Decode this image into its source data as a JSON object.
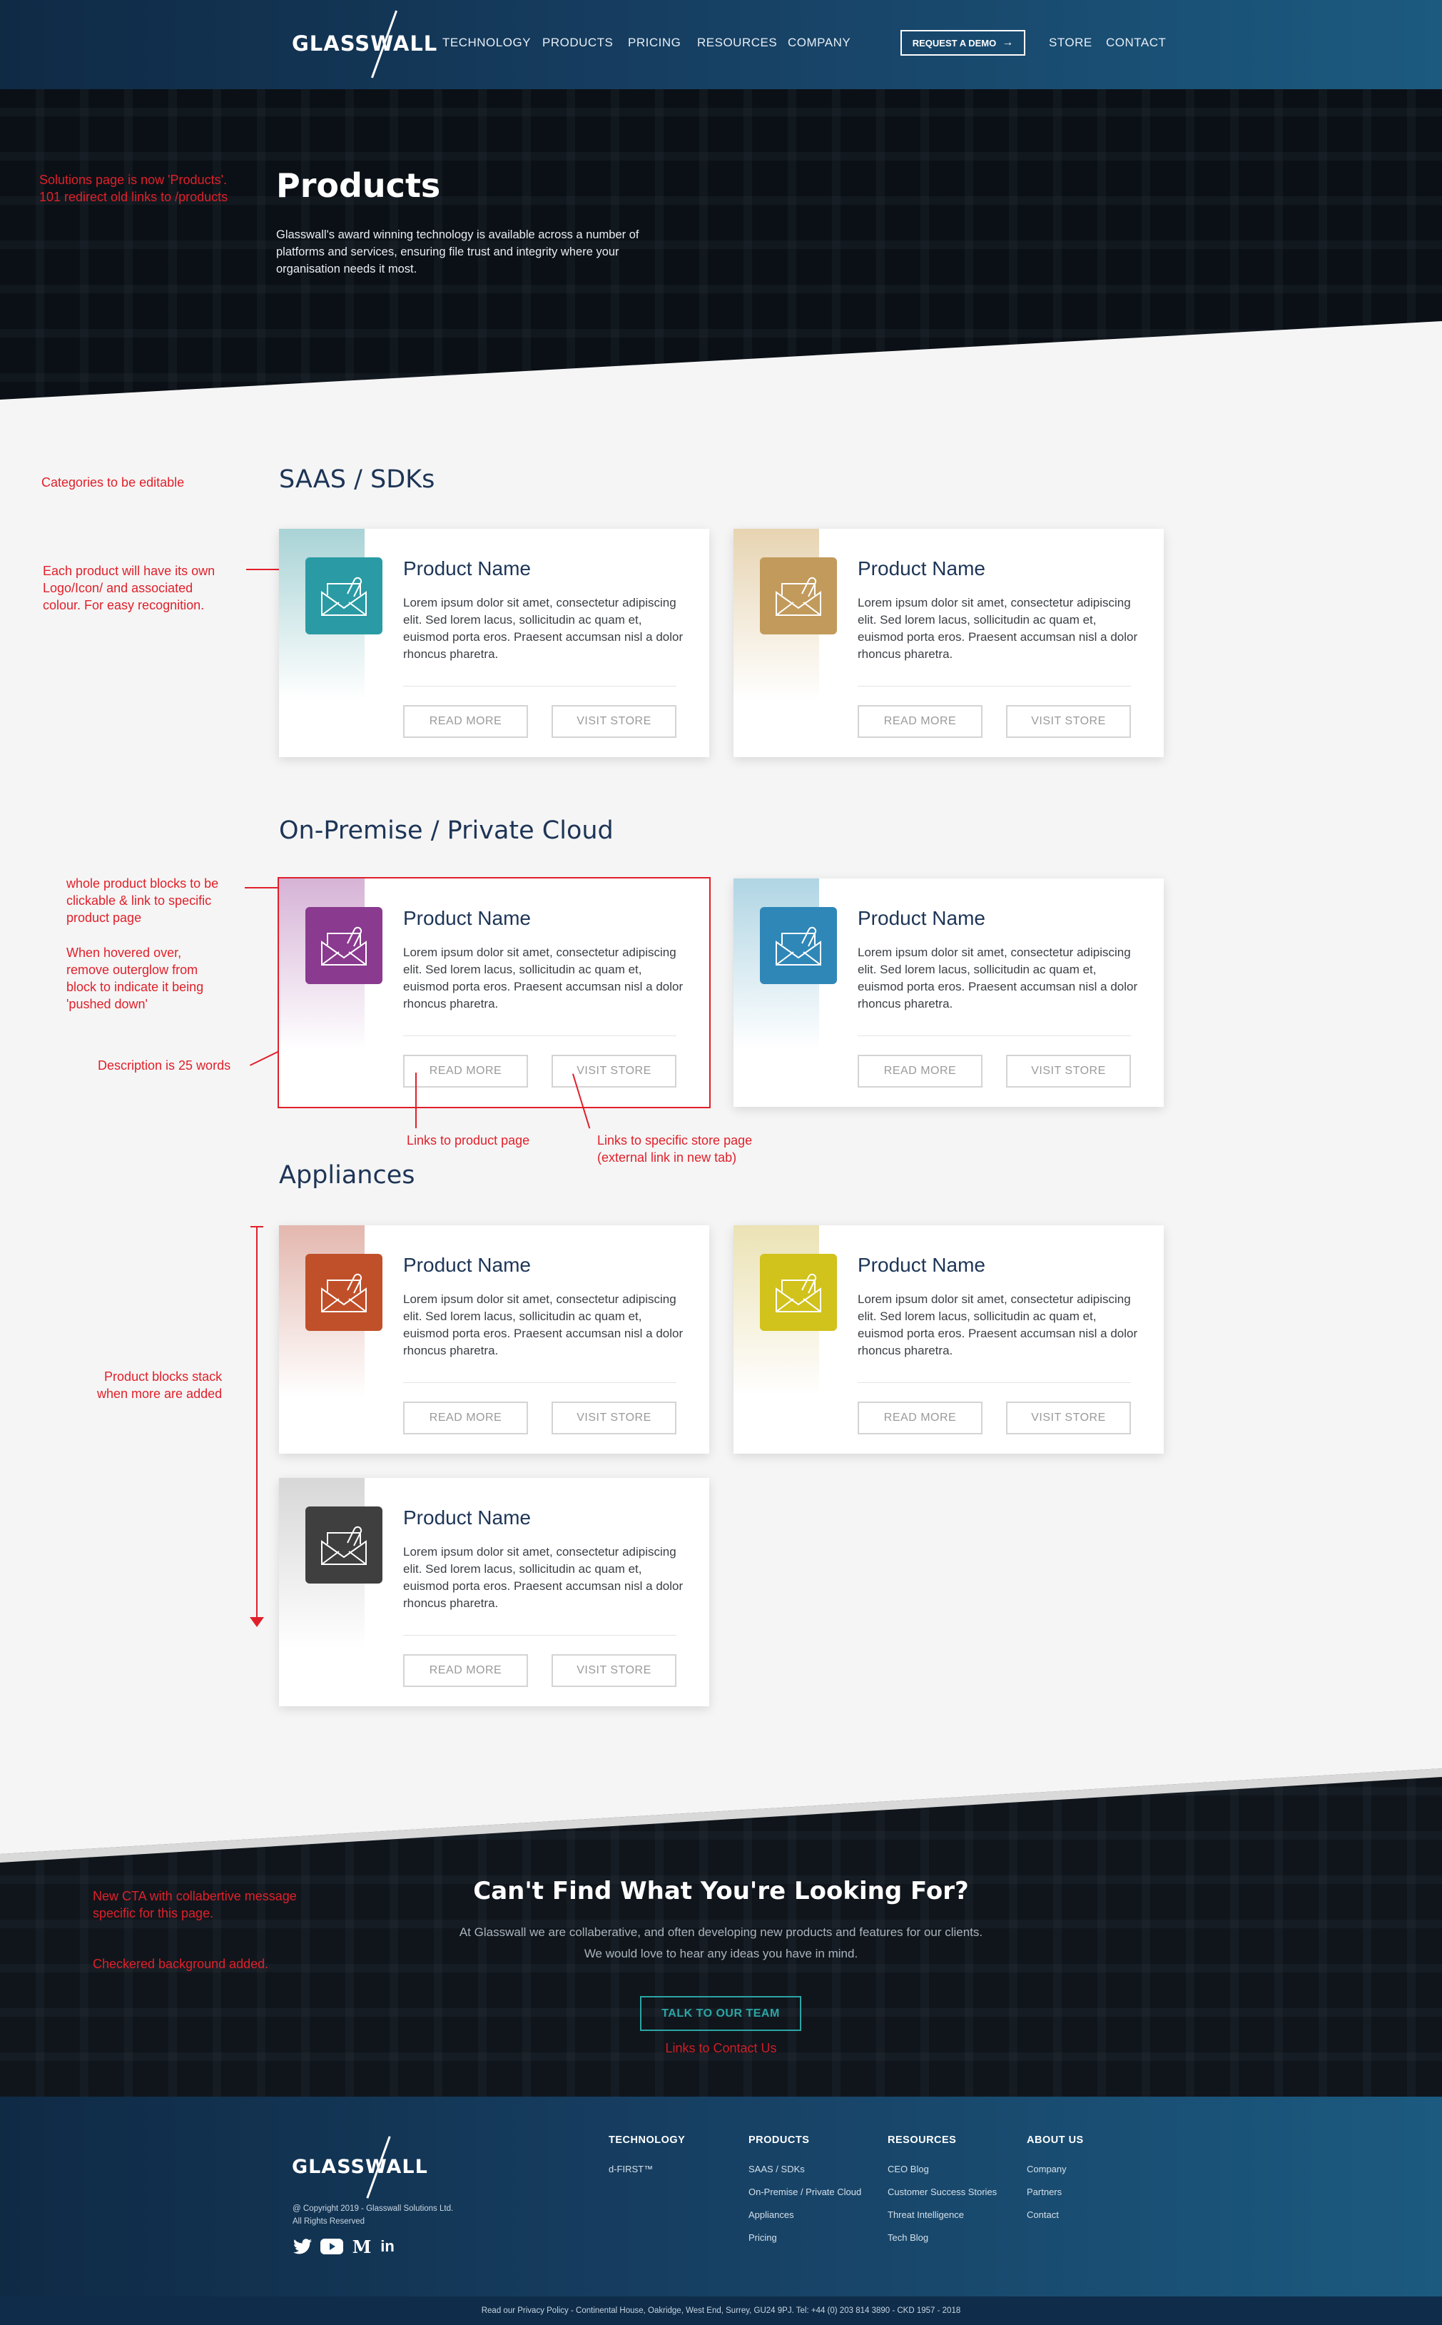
{
  "nav": {
    "logo": "GLASSWALL",
    "links": [
      "TECHNOLOGY",
      "PRODUCTS",
      "PRICING",
      "RESOURCES",
      "COMPANY"
    ],
    "demo_button": "REQUEST A DEMO",
    "demo_arrow": "→",
    "store": "STORE",
    "contact": "CONTACT"
  },
  "hero": {
    "title": "Products",
    "text": "Glasswall's award winning technology is available across a number of platforms and services, ensuring file trust and integrity where your organisation needs it most."
  },
  "annotations": {
    "solutions_1": "Solutions page is now 'Products'.",
    "solutions_2": "101 redirect old links to /products",
    "categories": "Categories to be editable",
    "logo_1": "Each product will have its own",
    "logo_2": "Logo/Icon/ and associated",
    "logo_3": "colour. For easy recognition.",
    "clickable_1": "whole product blocks to be",
    "clickable_2": "clickable & link to specific",
    "clickable_3": "product page",
    "hover_1": "When hovered over,",
    "hover_2": "remove outerglow from",
    "hover_3": "block to indicate it being",
    "hover_4": "'pushed down'",
    "description": "Description is 25 words",
    "links_product": "Links to product page",
    "links_store_1": "Links to specific store page",
    "links_store_2": "(external link in new tab)",
    "stack_1": "Product blocks stack",
    "stack_2": "when more are added",
    "cta_1": "New CTA with collabertive message",
    "cta_2": "specific for this page.",
    "checkered": "Checkered background added.",
    "contact_link": "Links to Contact Us"
  },
  "categories": [
    {
      "title": "SAAS / SDKs"
    },
    {
      "title": "On-Premise / Private Cloud"
    },
    {
      "title": "Appliances"
    }
  ],
  "product": {
    "name": "Product Name",
    "description": "Lorem ipsum dolor sit amet, consectetur adipiscing elit. Sed lorem lacus, sollicitudin ac quam et, euismod porta eros. Praesent accumsan nisl a dolor rhoncus pharetra.",
    "read_more": "READ MORE",
    "visit_store": "VISIT STORE"
  },
  "product_colors": {
    "teal": "#2a9ba4",
    "gold": "#c29a5b",
    "purple": "#8a3a8f",
    "blue": "#2f87b8",
    "orange": "#c0502a",
    "yellow": "#d1c21c",
    "charcoal": "#3f3f3f"
  },
  "cta": {
    "title": "Can't Find What You're Looking For?",
    "line1": "At Glasswall we are collaberative, and often developing new products and features for our clients.",
    "line2": "We would love to hear any ideas you have in mind.",
    "button": "TALK TO OUR TEAM"
  },
  "footer": {
    "logo": "GLASSWALL",
    "copyright_1": "@ Copyright 2019 - Glasswall Solutions Ltd.",
    "copyright_2": "All Rights Reserved",
    "columns": [
      {
        "head": "TECHNOLOGY",
        "links": [
          "d-FIRST™"
        ]
      },
      {
        "head": "PRODUCTS",
        "links": [
          "SAAS / SDKs",
          "On-Premise / Private Cloud",
          "Appliances",
          "Pricing"
        ]
      },
      {
        "head": "RESOURCES",
        "links": [
          "CEO Blog",
          "Customer Success Stories",
          "Threat Intelligence",
          "Tech Blog"
        ]
      },
      {
        "head": "ABOUT US",
        "links": [
          "Company",
          "Partners",
          "Contact"
        ]
      }
    ],
    "social_icons": [
      "twitter-icon",
      "youtube-icon",
      "medium-icon",
      "linkedin-icon"
    ],
    "medium_glyph": "M",
    "linkedin_glyph": "in",
    "bottom": "Read our Privacy Policy - Continental House, Oakridge, West End, Surrey, GU24 9PJ. Tel: +44 (0) 203 814 3890 - CKD 1957 - 2018"
  }
}
